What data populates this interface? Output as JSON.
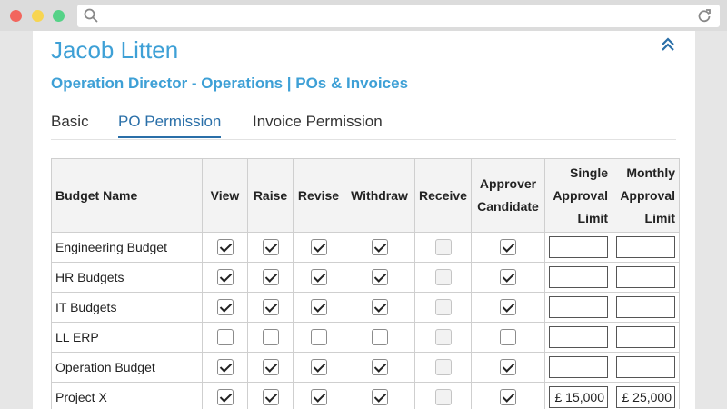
{
  "user": {
    "name": "Jacob Litten",
    "subtitle": "Operation Director - Operations | POs & Invoices"
  },
  "tabs": [
    {
      "label": "Basic",
      "active": false
    },
    {
      "label": "PO Permission",
      "active": true
    },
    {
      "label": "Invoice Permission",
      "active": false
    }
  ],
  "table": {
    "headers": {
      "budget_name": "Budget Name",
      "view": "View",
      "raise": "Raise",
      "revise": "Revise",
      "withdraw": "Withdraw",
      "receive": "Receive",
      "approver_candidate": [
        "Approver",
        "Candidate"
      ],
      "single_limit": [
        "Single",
        "Approval",
        "Limit"
      ],
      "monthly_limit": [
        "Monthly",
        "Approval",
        "Limit"
      ]
    },
    "rows": [
      {
        "name": "Engineering Budget",
        "view": true,
        "raise": true,
        "revise": true,
        "withdraw": true,
        "receive": false,
        "approver": true,
        "single_limit": "",
        "monthly_limit": ""
      },
      {
        "name": "HR Budgets",
        "view": true,
        "raise": true,
        "revise": true,
        "withdraw": true,
        "receive": false,
        "approver": true,
        "single_limit": "",
        "monthly_limit": ""
      },
      {
        "name": "IT Budgets",
        "view": true,
        "raise": true,
        "revise": true,
        "withdraw": true,
        "receive": false,
        "approver": true,
        "single_limit": "",
        "monthly_limit": ""
      },
      {
        "name": "LL ERP",
        "view": false,
        "raise": false,
        "revise": false,
        "withdraw": false,
        "receive": false,
        "approver": false,
        "single_limit": "",
        "monthly_limit": ""
      },
      {
        "name": "Operation Budget",
        "view": true,
        "raise": true,
        "revise": true,
        "withdraw": true,
        "receive": false,
        "approver": true,
        "single_limit": "",
        "monthly_limit": ""
      },
      {
        "name": "Project X",
        "view": true,
        "raise": true,
        "revise": true,
        "withdraw": true,
        "receive": false,
        "approver": true,
        "single_limit": "£ 15,000",
        "monthly_limit": "£ 25,000"
      }
    ]
  },
  "icons": {
    "search": "search-icon",
    "reload": "reload-icon",
    "collapse": "chevron-double-up-icon"
  },
  "colors": {
    "accent": "#3ea0d6",
    "tab_active": "#2a6fa8"
  }
}
